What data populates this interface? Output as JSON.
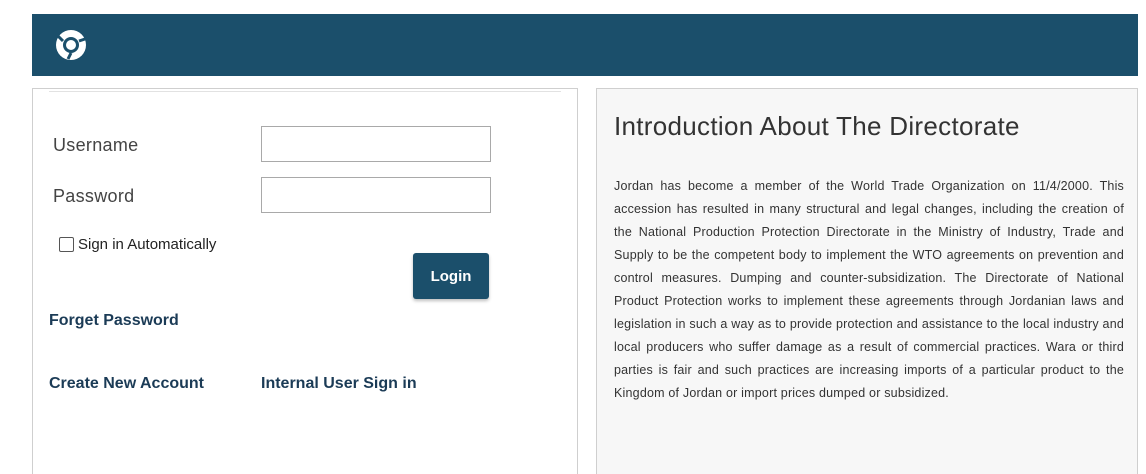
{
  "header": {
    "logo_icon": "chrome-style-logo-icon",
    "background": "#1b4f6b"
  },
  "login": {
    "username_label": "Username",
    "username_value": "",
    "password_label": "Password",
    "password_value": "",
    "auto_sign_in_label": "Sign in Automatically",
    "auto_sign_in_checked": false,
    "login_button": "Login",
    "forget_password": "Forget Password",
    "create_account": "Create New Account",
    "internal_sign_in": "Internal User Sign in"
  },
  "intro": {
    "title": "Introduction About The Directorate",
    "body": "Jordan has become a member of the World Trade Organization on 11/4/2000. This accession has resulted in many structural and legal changes, including the creation of the National Production Protection Directorate in the Ministry of Industry, Trade and Supply to be the competent body to implement the WTO agreements on prevention and control measures. Dumping and counter-subsidization. The Directorate of National Product Protection works to implement these agreements through Jordanian laws and legislation in such a way as to provide protection and assistance to the local industry and local producers who suffer damage as a result of commercial practices. Wara or third parties is fair and such practices are increasing imports of a particular product to the Kingdom of Jordan or import prices dumped or subsidized."
  },
  "colors": {
    "brand": "#1b4f6b",
    "link": "#1b3b56"
  }
}
